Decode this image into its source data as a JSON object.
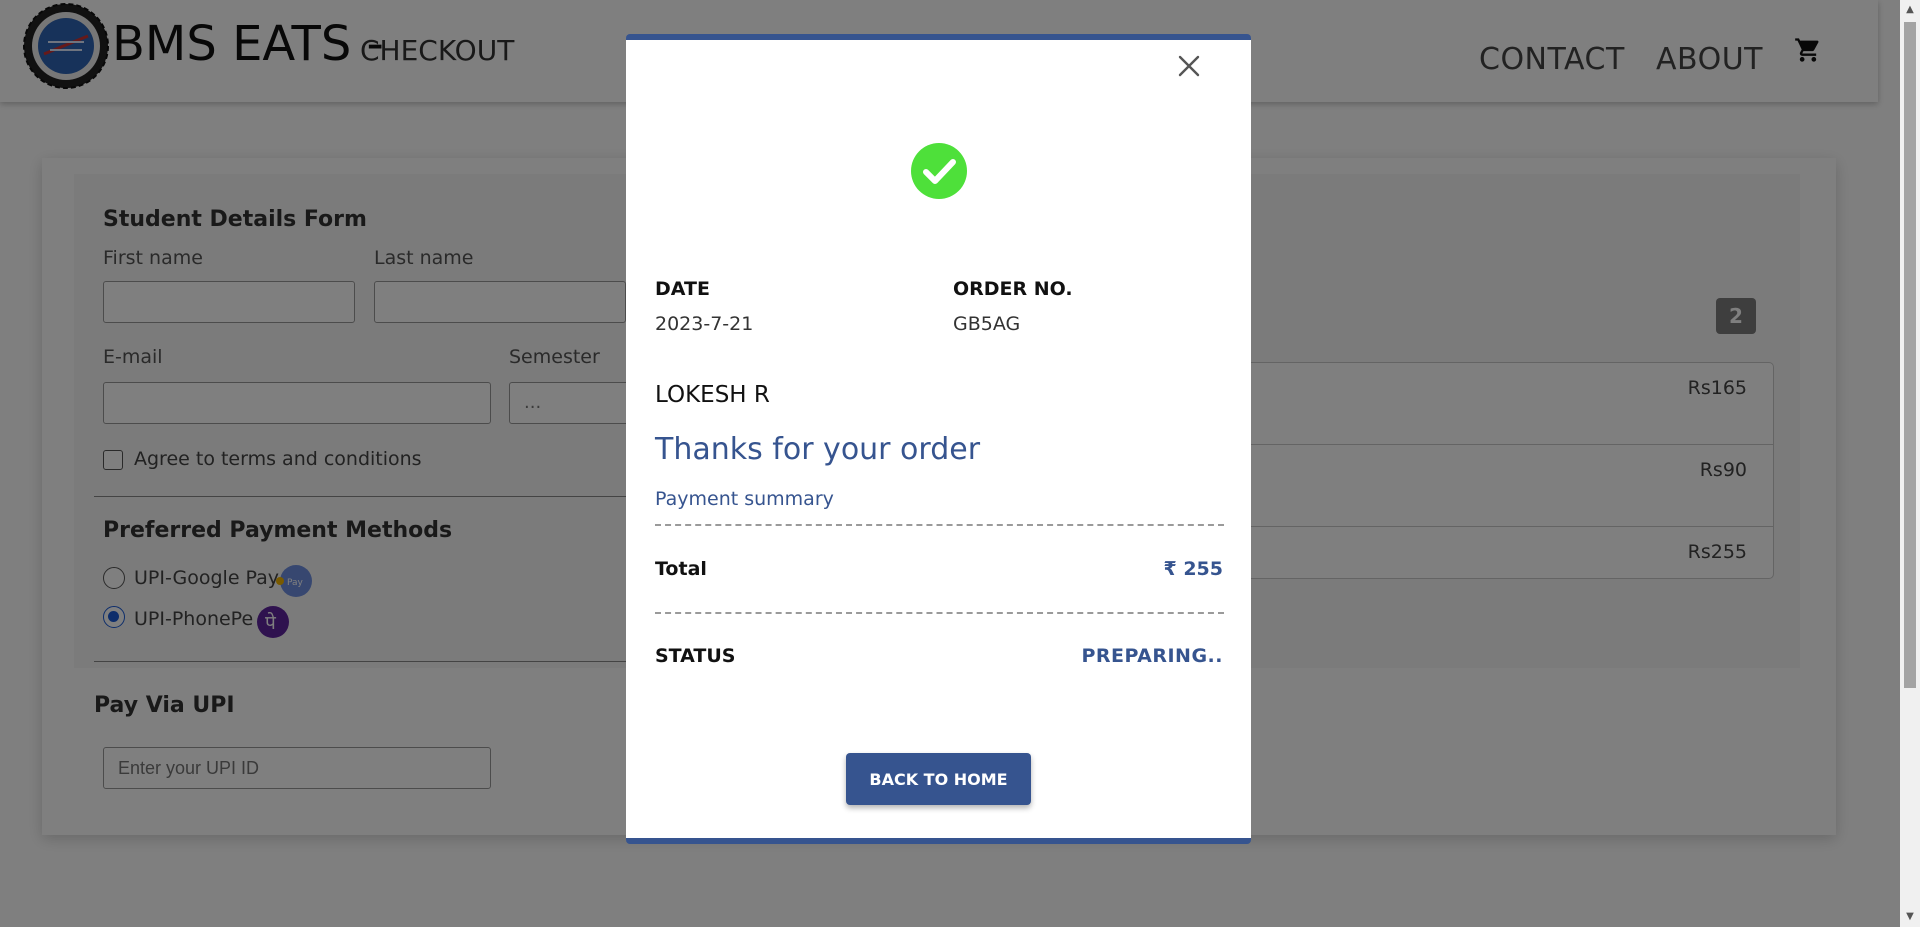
{
  "header": {
    "brand": "BMS EATS -",
    "subtitle": "CHECKOUT",
    "nav": [
      "CONTACT",
      "ABOUT"
    ]
  },
  "form": {
    "title": "Student Details Form",
    "first_name_label": "First name",
    "last_name_label": "Last name",
    "email_label": "E-mail",
    "semester_label": "Semester",
    "semester_value": "...",
    "terms_label": "Agree to terms and conditions",
    "payment_title": "Preferred Payment Methods",
    "payment_options": [
      "UPI-Google Pay",
      "UPI-PhonePe"
    ],
    "selected_payment": "UPI-PhonePe",
    "upi_title": "Pay Via UPI",
    "upi_placeholder": "Enter your UPI ID"
  },
  "cart": {
    "count": "2",
    "items": [
      {
        "price": "Rs165"
      },
      {
        "price": "Rs90"
      },
      {
        "price": "Rs255"
      }
    ]
  },
  "modal": {
    "date_label": "DATE",
    "date_value": "2023-7-21",
    "order_label": "ORDER NO.",
    "order_value": "GB5AG",
    "name": "LOKESH R",
    "thanks": "Thanks for your order",
    "summary": "Payment summary",
    "total_label": "Total",
    "total_value": "₹ 255",
    "status_label": "STATUS",
    "status_value": "PREPARING..",
    "button_label": "BACK TO HOME"
  },
  "colors": {
    "accent": "#36548f",
    "success": "#4ee03a",
    "phonepe": "#5f259f"
  }
}
